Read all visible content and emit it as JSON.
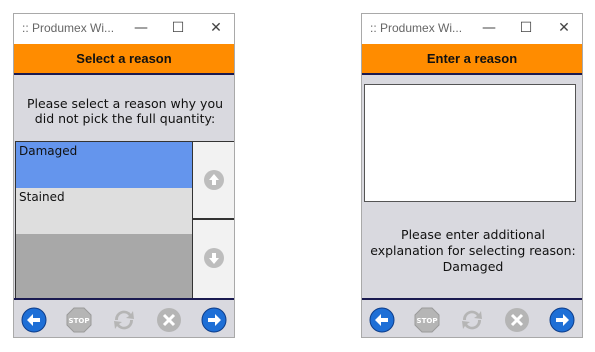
{
  "window1": {
    "title": ":: Produmex Wi...",
    "header": "Select a reason",
    "prompt": "Please select a reason why you did not pick the full quantity:",
    "list_items": [
      "Damaged",
      "Stained"
    ],
    "selected_item": "Damaged"
  },
  "window2": {
    "title": ":: Produmex Wi...",
    "header": "Enter a reason",
    "textarea_value": "",
    "info": "Please enter additional explanation for selecting reason: Damaged"
  },
  "titlebar_buttons": {
    "minimize": "—",
    "maximize": "☐",
    "close": "✕"
  },
  "footer_buttons": [
    "back-icon",
    "stop-icon",
    "refresh-icon",
    "cancel-icon",
    "forward-icon"
  ],
  "footer_stop_label": "STOP",
  "colors": {
    "header": "#ff8c00",
    "selected": "#6495ed",
    "nav_active": "#1e6fd6",
    "nav_disabled": "#b5b5b5"
  }
}
